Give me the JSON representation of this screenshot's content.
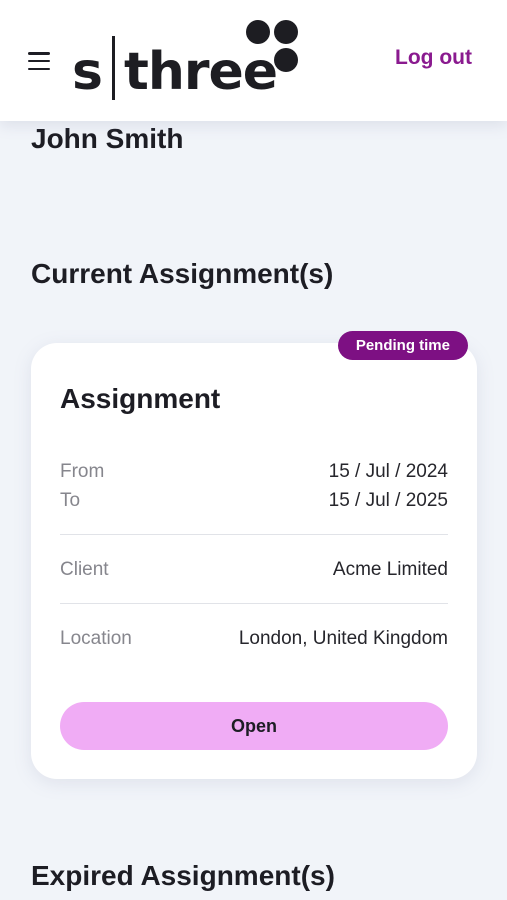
{
  "header": {
    "logo": {
      "left_text": "s",
      "right_text": "three"
    },
    "logout_label": "Log out"
  },
  "user": {
    "name": "John Smith"
  },
  "sections": {
    "current_title": "Current Assignment(s)",
    "expired_title": "Expired Assignment(s)"
  },
  "assignment": {
    "badge": "Pending time",
    "title": "Assignment",
    "from_label": "From",
    "from_value": "15 / Jul / 2024",
    "to_label": "To",
    "to_value": "15 / Jul / 2025",
    "client_label": "Client",
    "client_value": "Acme Limited",
    "location_label": "Location",
    "location_value": "London, United Kingdom",
    "open_label": "Open"
  },
  "colors": {
    "brand_purple": "#7d1083",
    "logout_purple": "#8a1a8f",
    "button_pink": "#f0acf5",
    "background": "#f1f4f9"
  },
  "icons": {
    "menu": "hamburger-menu-icon"
  }
}
